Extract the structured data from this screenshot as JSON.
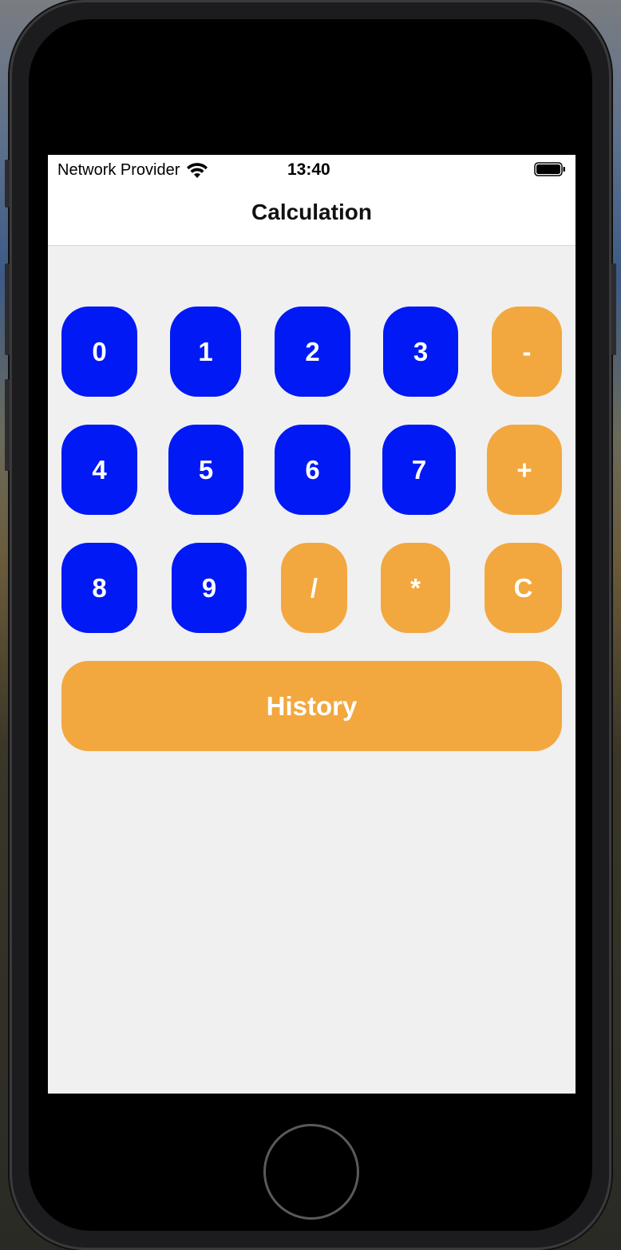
{
  "status_bar": {
    "carrier": "Network Provider",
    "time": "13:40"
  },
  "nav": {
    "title": "Calculation"
  },
  "keypad": {
    "rows": [
      [
        "0",
        "1",
        "2",
        "3",
        "-"
      ],
      [
        "4",
        "5",
        "6",
        "7",
        "+"
      ],
      [
        "8",
        "9",
        "/",
        "*",
        "C"
      ]
    ]
  },
  "history_label": "History",
  "colors": {
    "number_key": "#0019f5",
    "operator_key": "#f2a83f",
    "background": "#f0f0f0"
  }
}
